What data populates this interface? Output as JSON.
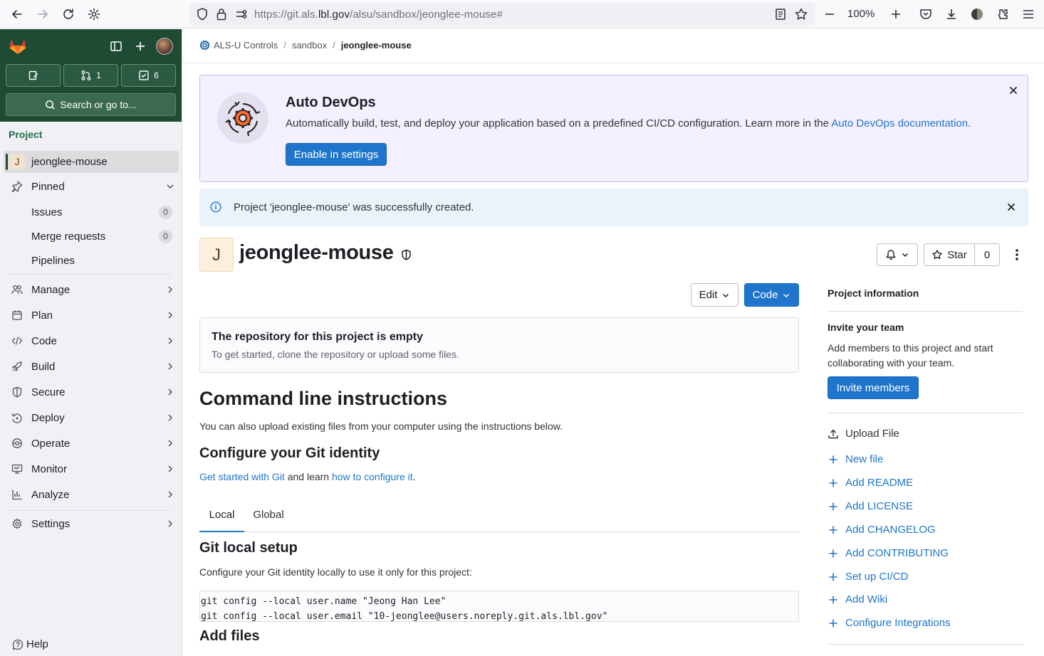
{
  "browser": {
    "url_prefix": "https://git.als.",
    "url_domain": "lbl.gov",
    "url_path": "/alsu/sandbox/jeonglee-mouse#",
    "zoom": "100%"
  },
  "sidebar": {
    "counters": {
      "merge_requests": "1",
      "todos": "6"
    },
    "search_label": "Search or go to...",
    "section_title": "Project",
    "project_initial": "J",
    "project_name": "jeonglee-mouse",
    "pinned_label": "Pinned",
    "pinned_items": [
      {
        "label": "Issues",
        "count": "0"
      },
      {
        "label": "Merge requests",
        "count": "0"
      },
      {
        "label": "Pipelines"
      }
    ],
    "nav_items": [
      {
        "label": "Manage"
      },
      {
        "label": "Plan"
      },
      {
        "label": "Code"
      },
      {
        "label": "Build"
      },
      {
        "label": "Secure"
      },
      {
        "label": "Deploy"
      },
      {
        "label": "Operate"
      },
      {
        "label": "Monitor"
      },
      {
        "label": "Analyze"
      }
    ],
    "settings_label": "Settings",
    "help_label": "Help"
  },
  "breadcrumb": {
    "group": "ALS-U Controls",
    "subgroup": "sandbox",
    "project": "jeonglee-mouse"
  },
  "devops_banner": {
    "title": "Auto DevOps",
    "text": "Automatically build, test, and deploy your application based on a predefined CI/CD configuration. Learn more in the",
    "link": "Auto DevOps documentation",
    "button": "Enable in settings"
  },
  "alert": {
    "message": "Project 'jeonglee-mouse' was successfully created."
  },
  "project": {
    "initial": "J",
    "name": "jeonglee-mouse",
    "star_label": "Star",
    "star_count": "0",
    "edit_label": "Edit",
    "code_label": "Code"
  },
  "empty_repo": {
    "title": "The repository for this project is empty",
    "desc": "To get started, clone the repository or upload some files."
  },
  "instructions": {
    "title": "Command line instructions",
    "desc": "You can also upload existing files from your computer using the instructions below.",
    "identity_title": "Configure your Git identity",
    "link1": "Get started with Git",
    "middle": " and learn ",
    "link2": "how to configure it",
    "end": ".",
    "tabs": [
      "Local",
      "Global"
    ],
    "local_title": "Git local setup",
    "local_desc": "Configure your Git identity locally to use it only for this project:",
    "code_line1": "git config --local user.name \"Jeong Han Lee\"",
    "code_line2": "git config --local user.email \"10-jeonglee@users.noreply.git.als.lbl.gov\"",
    "add_files_title": "Add files"
  },
  "project_info": {
    "title": "Project information",
    "invite_title": "Invite your team",
    "invite_text": "Add members to this project and start collaborating with your team.",
    "invite_button": "Invite members",
    "upload": "Upload File",
    "links": [
      "New file",
      "Add README",
      "Add LICENSE",
      "Add CHANGELOG",
      "Add CONTRIBUTING",
      "Set up CI/CD",
      "Add Wiki",
      "Configure Integrations"
    ]
  },
  "colors": {
    "sidebar_header": "#1f4a34",
    "accent": "#1f75cb",
    "devops_bg": "#f4f0ff",
    "info_bg": "#e9f3fc"
  }
}
